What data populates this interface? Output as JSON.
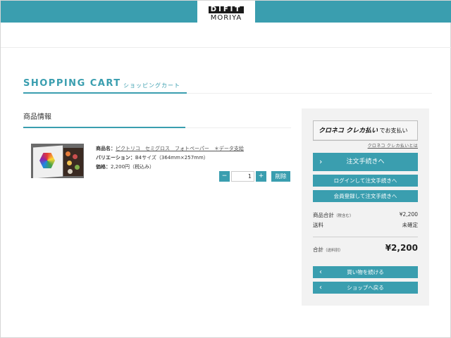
{
  "colors": {
    "accent": "#3a9eaf",
    "sidebar_bg": "#f2f2f2"
  },
  "logo": {
    "top": "DIFIT",
    "bottom": "MORIYA"
  },
  "page": {
    "title_en": "SHOPPING CART",
    "title_jp": "ショッピングカート"
  },
  "section": {
    "title": "商品情報"
  },
  "item": {
    "name_label": "商品名：",
    "name": "ピクトリコ　セミグロス　フォトペーパー　＊データ支給",
    "variation_label": "バリエーション：",
    "variation": "B4サイズ（364mm×257mm）",
    "price_label": "価格：",
    "price": "2,200円",
    "price_note": "（税込み）",
    "quantity": "1",
    "minus": "−",
    "plus": "+",
    "delete_label": "削除"
  },
  "sidebar": {
    "kuroneko_brand": "クロネコ クレカ払い",
    "kuroneko_suffix": "でお支払い",
    "kuroneko_link": "クロネコ クレカ払いとは",
    "checkout_label": "注文手続きへ",
    "login_checkout_label": "ログインして注文手続きへ",
    "register_checkout_label": "会員登録して注文手続きへ",
    "subtotal_label": "商品合計",
    "subtotal_note": "（税含む）",
    "subtotal_value": "¥2,200",
    "shipping_label": "送料",
    "shipping_value": "未確定",
    "total_label": "合計",
    "total_note": "（送料別）",
    "total_value": "¥2,200",
    "continue_label": "買い物を続ける",
    "back_label": "ショップへ戻る"
  },
  "icons": {
    "chevron": "chevron-left-icon",
    "checkout_chevron": "chevron-right-icon"
  }
}
